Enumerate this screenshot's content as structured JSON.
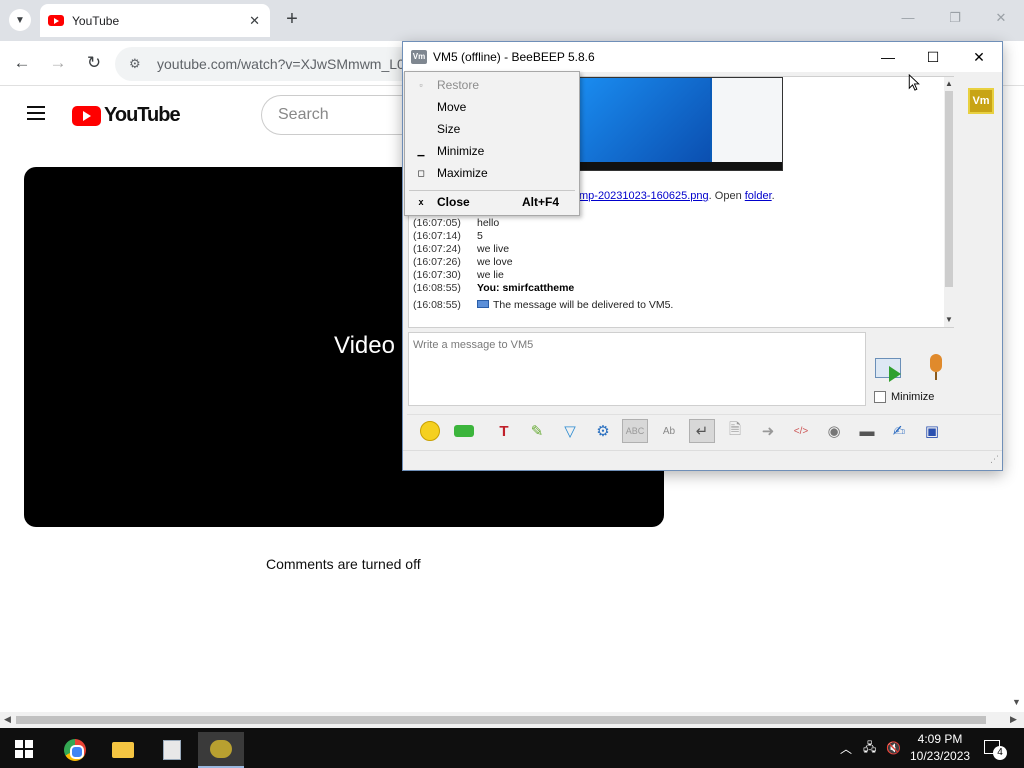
{
  "browser": {
    "tab_title": "YouTube",
    "tab_close": "✕",
    "new_tab": "+",
    "url": "youtube.com/watch?v=XJwSMmwm_L0",
    "controls": {
      "minimize": "—",
      "restore": "❐",
      "close": "✕"
    }
  },
  "youtube": {
    "logo_text": "YouTube",
    "search_placeholder": "Search",
    "video_text": "Video",
    "comments": "Comments are turned off"
  },
  "beebeep": {
    "title": "VM5 (offline) - BeeBEEP 5.8.6",
    "app_icon_text": "Vm",
    "file_line": {
      "link": "mp-20231023-160625.png",
      "sep": ". Open ",
      "folder": "folder",
      "end": "."
    },
    "messages": [
      {
        "time": "(16:07:05)",
        "text": "hello",
        "bold": false
      },
      {
        "time": "(16:07:14)",
        "text": "5",
        "bold": false
      },
      {
        "time": "(16:07:24)",
        "text": "we live",
        "bold": false
      },
      {
        "time": "(16:07:26)",
        "text": "we love",
        "bold": false
      },
      {
        "time": "(16:07:30)",
        "text": "we lie",
        "bold": false
      },
      {
        "time": "(16:08:55)",
        "text": "You: smirfcattheme",
        "bold": true
      },
      {
        "time": "(16:08:55)",
        "text": "The message will be delivered to VM5.",
        "bold": false
      }
    ],
    "compose_placeholder": "Write a message to VM5",
    "minimize_label": "Minimize",
    "user_avatar": "Vm"
  },
  "context_menu": {
    "items": [
      {
        "label": "Restore",
        "icon": "restore-icon",
        "glyph": "▫",
        "disabled": true
      },
      {
        "label": "Move",
        "icon": "",
        "glyph": "",
        "disabled": false
      },
      {
        "label": "Size",
        "icon": "",
        "glyph": "",
        "disabled": false
      },
      {
        "label": "Minimize",
        "icon": "minimize-icon",
        "glyph": "▁",
        "disabled": false
      },
      {
        "label": "Maximize",
        "icon": "maximize-icon",
        "glyph": "◻",
        "disabled": false
      },
      {
        "label": "Close",
        "icon": "close-icon",
        "glyph": "x",
        "shortcut": "Alt+F4",
        "disabled": false,
        "bold": true
      }
    ]
  },
  "taskbar": {
    "time": "4:09 PM",
    "date": "10/23/2023",
    "notification_count": "4"
  }
}
